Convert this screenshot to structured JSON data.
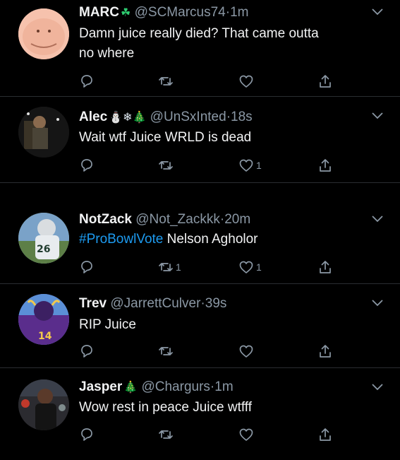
{
  "tweets": [
    {
      "name": "MARC",
      "emoji": "☘",
      "handle": "@SCMarcus74",
      "time": "1m",
      "text_lines": [
        "Damn juice really died? That came outta",
        "no where"
      ],
      "hashtag": "",
      "reply_count": "",
      "retweet_count": "",
      "like_count": ""
    },
    {
      "name": "Alec",
      "emoji": "⛄❄🎄",
      "handle": "@UnSxInted",
      "time": "18s",
      "text_lines": [
        "Wait wtf Juice WRLD is dead"
      ],
      "hashtag": "",
      "reply_count": "",
      "retweet_count": "",
      "like_count": "1"
    },
    {
      "name": "NotZack",
      "emoji": "",
      "handle": "@Not_Zackkk",
      "time": "20m",
      "text_lines": [
        " Nelson Agholor"
      ],
      "hashtag": "#ProBowlVote",
      "reply_count": "",
      "retweet_count": "1",
      "like_count": "1"
    },
    {
      "name": "Trev",
      "emoji": "",
      "handle": "@JarrettCulver",
      "time": "39s",
      "text_lines": [
        "RIP Juice"
      ],
      "hashtag": "",
      "reply_count": "",
      "retweet_count": "",
      "like_count": ""
    },
    {
      "name": "Jasper",
      "emoji": "🎄",
      "handle": "@Chargurs",
      "time": "1m",
      "text_lines": [
        "Wow rest in peace Juice wtfff"
      ],
      "hashtag": "",
      "reply_count": "",
      "retweet_count": "",
      "like_count": ""
    }
  ],
  "separator": "·",
  "colors": {
    "background": "#000000",
    "text": "#f2f3f4",
    "muted": "#8b98a5",
    "link": "#1d9bf0",
    "divider": "#2a2d31"
  },
  "icons": [
    "reply-icon",
    "retweet-icon",
    "like-icon",
    "share-icon",
    "chevron-down-icon"
  ]
}
